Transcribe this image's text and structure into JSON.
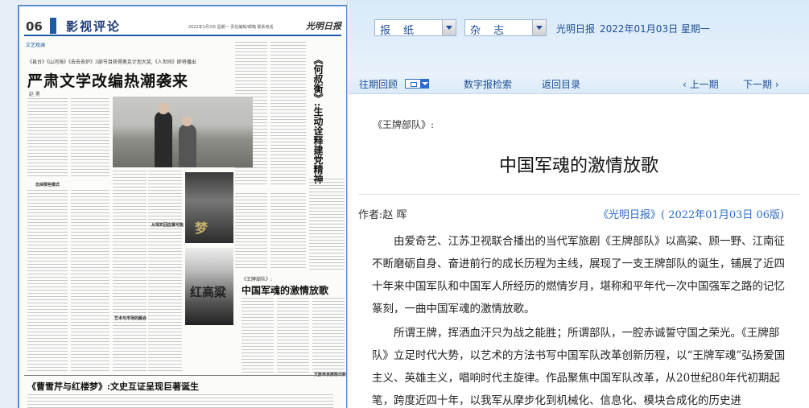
{
  "paper_image": {
    "page_number": "06",
    "section": "影视评论",
    "dateline": "2022年1月3日 星期一 责任编辑/邮箱 联系电话",
    "logo": "光明日报",
    "tag": "文艺观澜",
    "kicker": "《县台》《山河海》《去去去炉》3部节目获得奥克计划大奖,《人世间》即将播出",
    "headline": "严肃文学改编热潮袭来",
    "byline": "赵 勇",
    "vertical_headline": "《何叔衡》:生动诠释建党精神",
    "sub_kicker": "《王牌部队》:",
    "sub_headline": "中国军魂的激情放歌",
    "bottom_headline": "《曹雪芹与红楼梦》:文史互证呈现巨著诞生",
    "poster1_text": "梦",
    "poster2_text": "红高粱",
    "mini_heads": [
      "忘掉那些模式",
      "艺术与市场的融合",
      "从现实回应着可能",
      "文脉传承推陈出新"
    ]
  },
  "selects": {
    "paper": "报 纸",
    "magazine": "杂 志"
  },
  "top": {
    "paper_name": "光明日报",
    "date": "2022年01月03日  星期一"
  },
  "nav": {
    "history": "往期回顾",
    "search": "数字报检索",
    "index": "返回目录",
    "prev": "‹  上一期",
    "next": "下一期  ›"
  },
  "article": {
    "intro": "《王牌部队》:",
    "title": "中国军魂的激情放歌",
    "author": "作者:赵 晖",
    "source": "《光明日报》( 2022年01月03日  06版)",
    "paragraphs": [
      "由爱奇艺、江苏卫视联合播出的当代军旅剧《王牌部队》以高粱、顾一野、江南征不断磨砺自身、奋进前行的成长历程为主线，展现了一支王牌部队的诞生，铺展了近四十年来中国军队和中国军人所经历的燃情岁月，堪称和平年代一次中国强军之路的记忆篆刻，一曲中国军魂的激情放歌。",
      "所谓王牌，挥洒血汗只为战之能胜；所谓部队，一腔赤诚誓守国之荣光。《王牌部队》立足时代大势，以艺术的方法书写中国军队改革创新历程，以“王牌军魂”弘扬爱国主义、英雄主义，唱响时代主旋律。作品聚焦中国军队改革，从20世纪80年代初期起笔，跨度近四十年，以我军从摩步化到机械化、信息化、模块合成化的历史进"
    ]
  }
}
